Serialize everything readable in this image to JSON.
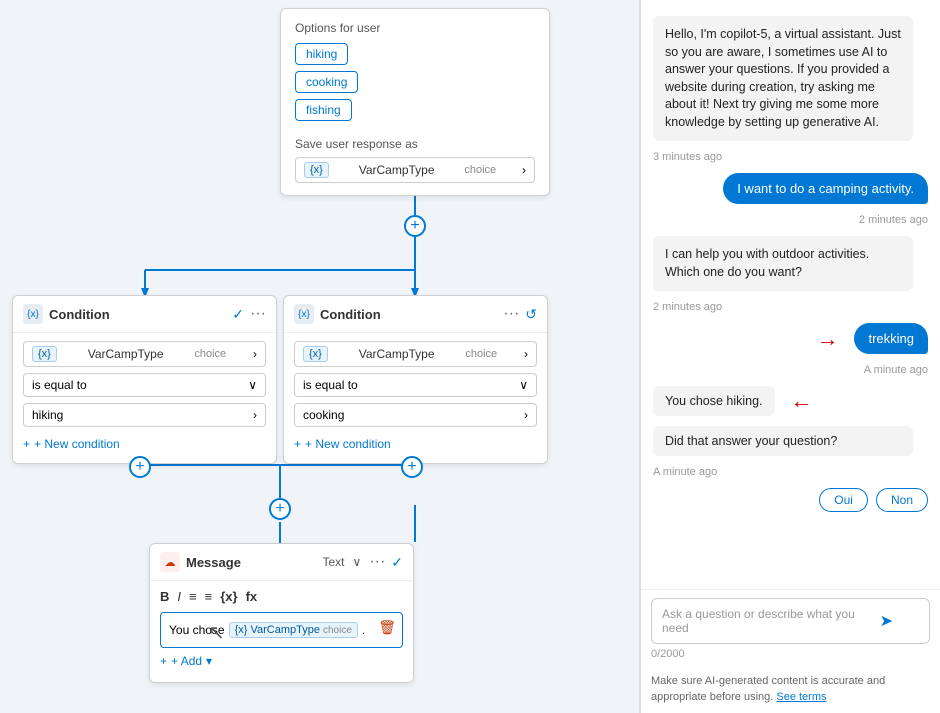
{
  "canvas": {
    "options_card": {
      "title": "Options for user",
      "options": [
        "hiking",
        "cooking",
        "fishing"
      ],
      "save_label": "Save user response as",
      "var_tag": "{x}",
      "var_name": "VarCampType",
      "var_type": "choice",
      "chevron": "›"
    },
    "condition1": {
      "title": "Condition",
      "icon": "{x}",
      "var_tag": "{x}",
      "var_name": "VarCampType",
      "var_type": "choice",
      "operator": "is equal to",
      "value": "hiking",
      "new_condition": "+ New condition",
      "dots": "···",
      "check": "✓"
    },
    "condition2": {
      "title": "Condition",
      "icon": "{x}",
      "var_tag": "{x}",
      "var_name": "VarCampType",
      "var_type": "choice",
      "operator": "is equal to",
      "value": "cooking",
      "new_condition": "+ New condition",
      "dots": "···",
      "history": "↺"
    },
    "message_card": {
      "title": "Message",
      "type_label": "Text",
      "check": "✓",
      "dots": "···",
      "toolbar": {
        "bold": "B",
        "italic": "I",
        "list1": "≡",
        "list2": "≡",
        "var": "{x}",
        "fx": "fx"
      },
      "content_text": "You chose",
      "var_tag": "{x}",
      "var_name": "VarCampType",
      "var_type": "choice",
      "period": ".",
      "add_label": "+ Add",
      "chevron_down": "▾"
    },
    "plus_positions": []
  },
  "chat": {
    "bot_intro": "Hello, I'm copilot-5, a virtual assistant. Just so you are aware, I sometimes use AI to answer your questions. If you provided a website during creation, try asking me about it! Next try giving me some more knowledge by setting up generative AI.",
    "timestamp1": "3 minutes ago",
    "user_msg1": "I want to do a camping activity.",
    "timestamp2": "2 minutes ago",
    "bot_msg1": "I can help you with outdoor activities. Which one do you want?",
    "timestamp3": "2 minutes ago",
    "user_msg2": "trekking",
    "timestamp4": "A minute ago",
    "bot_msg2": "You chose hiking.",
    "bot_msg3": "Did that answer your question?",
    "timestamp5": "A minute ago",
    "btn_oui": "Oui",
    "btn_non": "Non",
    "input_placeholder": "Ask a question or describe what you need",
    "counter": "0/2000",
    "disclaimer": "Make sure AI-generated content is accurate and appropriate before using.",
    "see_terms": "See terms"
  }
}
